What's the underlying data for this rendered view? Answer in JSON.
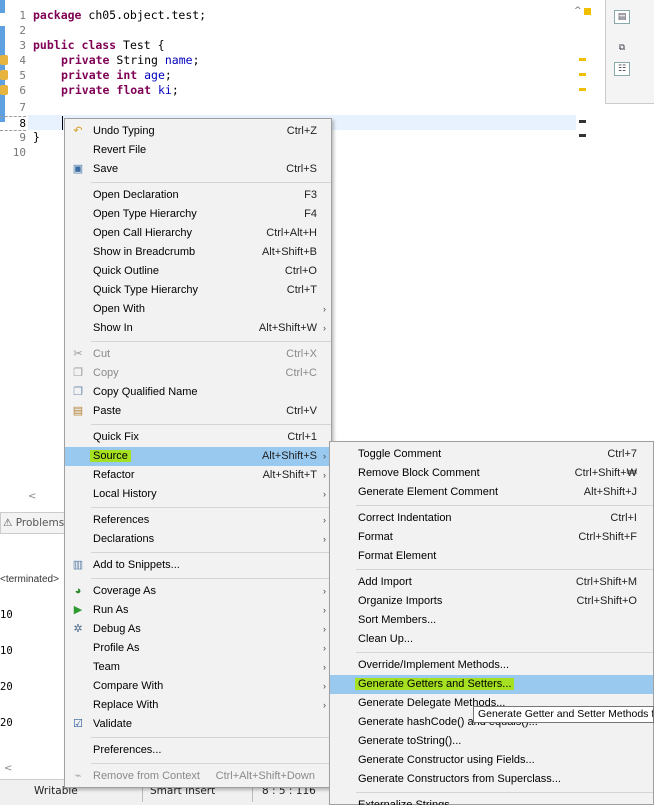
{
  "editor": {
    "line_numbers": [
      "1",
      "2",
      "3",
      "4",
      "5",
      "6",
      "7",
      "8",
      "9",
      "10"
    ],
    "code": {
      "l1_kw": "package",
      "l1_rest": " ch05.object.test;",
      "l3_kw1": "public",
      "l3_kw2": "class",
      "l3_rest": " Test {",
      "l4_kw": "private",
      "l4_type": " String ",
      "l4_field": "name",
      "l4_end": ";",
      "l5_kw1": "private",
      "l5_kw2": "int",
      "l5_field": "age",
      "l5_end": ";",
      "l6_kw1": "private",
      "l6_kw2": "float",
      "l6_field": "ki",
      "l6_end": ";",
      "l9": "}"
    }
  },
  "bottom": {
    "problems_tab": "Problems",
    "console_terminated": "<terminated>",
    "console_lines": [
      "10",
      "10",
      "20",
      "20"
    ],
    "hscroll_left": "<",
    "hscroll_left2": "<"
  },
  "statusbar": {
    "writable": "Writable",
    "insert_mode": "Smart Insert",
    "position": "8 : 5 : 116"
  },
  "context_menu": [
    {
      "label": "Undo Typing",
      "shortcut": "Ctrl+Z",
      "icon": "undo-icon"
    },
    {
      "label": "Revert File",
      "shortcut": ""
    },
    {
      "label": "Save",
      "shortcut": "Ctrl+S",
      "icon": "save-icon"
    },
    {
      "label": "Open Declaration",
      "shortcut": "F3"
    },
    {
      "label": "Open Type Hierarchy",
      "shortcut": "F4"
    },
    {
      "label": "Open Call Hierarchy",
      "shortcut": "Ctrl+Alt+H"
    },
    {
      "label": "Show in Breadcrumb",
      "shortcut": "Alt+Shift+B"
    },
    {
      "label": "Quick Outline",
      "shortcut": "Ctrl+O"
    },
    {
      "label": "Quick Type Hierarchy",
      "shortcut": "Ctrl+T"
    },
    {
      "label": "Open With",
      "shortcut": ""
    },
    {
      "label": "Show In",
      "shortcut": "Alt+Shift+W"
    },
    {
      "label": "Cut",
      "shortcut": "Ctrl+X",
      "icon": "cut-icon"
    },
    {
      "label": "Copy",
      "shortcut": "Ctrl+C",
      "icon": "copy-icon"
    },
    {
      "label": "Copy Qualified Name",
      "shortcut": "",
      "icon": "copy-qualified-name-icon"
    },
    {
      "label": "Paste",
      "shortcut": "Ctrl+V",
      "icon": "paste-icon"
    },
    {
      "label": "Quick Fix",
      "shortcut": "Ctrl+1"
    },
    {
      "label": "Source",
      "shortcut": "Alt+Shift+S"
    },
    {
      "label": "Refactor",
      "shortcut": "Alt+Shift+T"
    },
    {
      "label": "Local History",
      "shortcut": ""
    },
    {
      "label": "References",
      "shortcut": ""
    },
    {
      "label": "Declarations",
      "shortcut": ""
    },
    {
      "label": "Add to Snippets...",
      "shortcut": "",
      "icon": "snippets-icon"
    },
    {
      "label": "Coverage As",
      "shortcut": "",
      "icon": "coverage-icon"
    },
    {
      "label": "Run As",
      "shortcut": "",
      "icon": "run-icon"
    },
    {
      "label": "Debug As",
      "shortcut": "",
      "icon": "debug-icon"
    },
    {
      "label": "Profile As",
      "shortcut": ""
    },
    {
      "label": "Team",
      "shortcut": ""
    },
    {
      "label": "Compare With",
      "shortcut": ""
    },
    {
      "label": "Replace With",
      "shortcut": ""
    },
    {
      "label": "Validate",
      "shortcut": "",
      "icon": "checkbox-checked-icon"
    },
    {
      "label": "Preferences...",
      "shortcut": ""
    },
    {
      "label": "Remove from Context",
      "shortcut": "Ctrl+Alt+Shift+Down"
    }
  ],
  "source_submenu": [
    {
      "label": "Toggle Comment",
      "shortcut": "Ctrl+7"
    },
    {
      "label": "Remove Block Comment",
      "shortcut": "Ctrl+Shift+₩"
    },
    {
      "label": "Generate Element Comment",
      "shortcut": "Alt+Shift+J"
    },
    {
      "label": "Correct Indentation",
      "shortcut": "Ctrl+I"
    },
    {
      "label": "Format",
      "shortcut": "Ctrl+Shift+F"
    },
    {
      "label": "Format Element",
      "shortcut": ""
    },
    {
      "label": "Add Import",
      "shortcut": "Ctrl+Shift+M"
    },
    {
      "label": "Organize Imports",
      "shortcut": "Ctrl+Shift+O"
    },
    {
      "label": "Sort Members...",
      "shortcut": ""
    },
    {
      "label": "Clean Up...",
      "shortcut": ""
    },
    {
      "label": "Override/Implement Methods...",
      "shortcut": ""
    },
    {
      "label": "Generate Getters and Setters...",
      "shortcut": ""
    },
    {
      "label": "Generate Delegate Methods...",
      "shortcut": ""
    },
    {
      "label": "Generate hashCode() and equals()...",
      "shortcut": ""
    },
    {
      "label": "Generate toString()...",
      "shortcut": ""
    },
    {
      "label": "Generate Constructor using Fields...",
      "shortcut": ""
    },
    {
      "label": "Generate Constructors from Superclass...",
      "shortcut": ""
    },
    {
      "label": "Externalize Strings...",
      "shortcut": ""
    }
  ],
  "tooltip": "Generate Getter and Setter Methods for",
  "colors": {
    "menu_selection": "#99c9ef",
    "highlight_marker": "#a5e021",
    "keyword": "#7f0055",
    "field": "#0000c0"
  }
}
